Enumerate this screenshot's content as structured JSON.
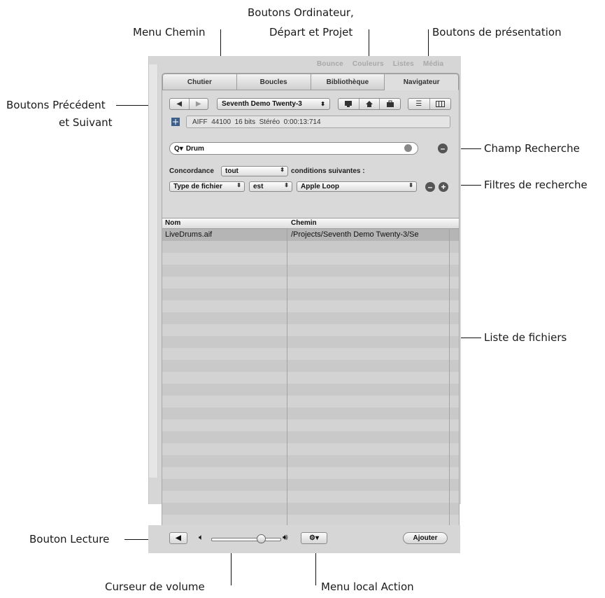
{
  "callouts": {
    "boutons_ordinateur_line1": "Boutons Ordinateur,",
    "boutons_ordinateur_line2": "Départ et Projet",
    "menu_chemin": "Menu Chemin",
    "boutons_presentation": "Boutons de présentation",
    "boutons_precedent_line1": "Boutons Précédent",
    "boutons_precedent_line2": "et Suivant",
    "champ_recherche": "Champ Recherche",
    "filtres_recherche": "Filtres de recherche",
    "liste_fichiers": "Liste de fichiers",
    "bouton_lecture": "Bouton Lecture",
    "curseur_volume": "Curseur de volume",
    "menu_action": "Menu local Action"
  },
  "window": {
    "top_tabs": [
      "Bounce",
      "Couleurs",
      "Listes",
      "Média"
    ],
    "tabs": [
      {
        "label": "Chutier"
      },
      {
        "label": "Boucles"
      },
      {
        "label": "Bibliothèque"
      },
      {
        "label": "Navigateur",
        "active": true
      }
    ],
    "path_menu": "Seventh Demo Twenty-3",
    "info": {
      "format": "AIFF",
      "rate": "44100",
      "bits": "16 bits",
      "channels": "Stéréo",
      "duration": "0:00:13:714"
    },
    "search": {
      "value": "Drum"
    },
    "filter": {
      "concordance_label": "Concordance",
      "concordance_value": "tout",
      "conditions_label": "conditions suivantes :",
      "field": "Type de fichier",
      "operator": "est",
      "value": "Apple Loop"
    },
    "list": {
      "columns": [
        "Nom",
        "Chemin"
      ],
      "rows": [
        {
          "name": "LiveDrums.aif",
          "path": "/Projects/Seventh Demo Twenty-3/Se"
        }
      ]
    },
    "add_button": "Ajouter"
  },
  "colors": {
    "panel_bg": "#d9d9d9",
    "selected_row": "#b5b5b5",
    "round_button": "#555555"
  },
  "icons": {
    "back": "left-triangle-icon",
    "forward": "right-triangle-icon",
    "computer": "computer-icon",
    "home": "home-icon",
    "project": "briefcase-icon",
    "list_view": "list-view-icon",
    "column_view": "column-view-icon",
    "search": "magnifier-icon",
    "play": "play-icon",
    "volume_low": "speaker-low-icon",
    "volume_high": "speaker-high-icon",
    "action": "gear-icon"
  },
  "volume": {
    "level": 0.72
  }
}
